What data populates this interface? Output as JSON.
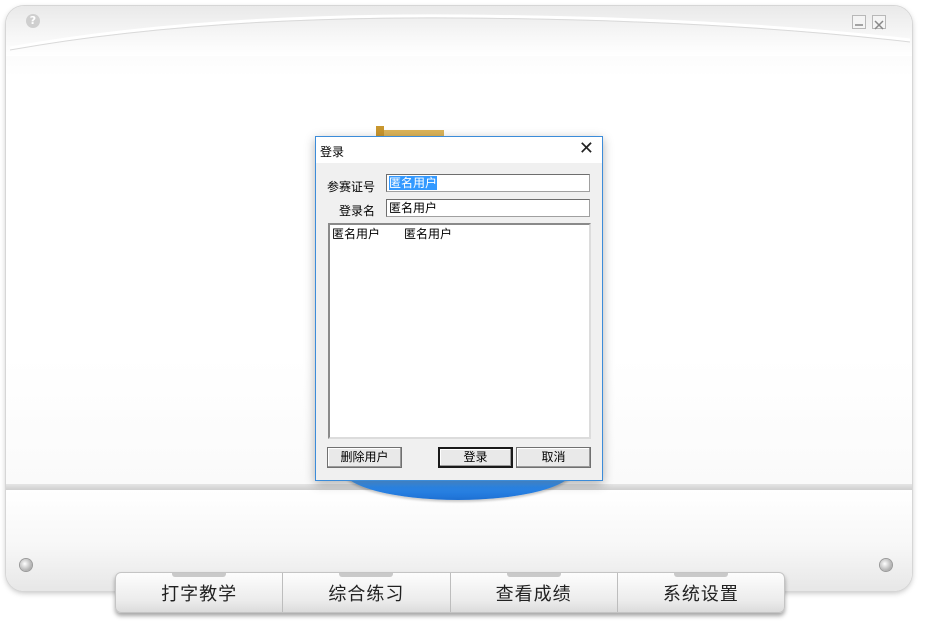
{
  "window": {
    "help_glyph": "?"
  },
  "tabs": [
    {
      "label": "打字教学"
    },
    {
      "label": "综合练习"
    },
    {
      "label": "查看成绩"
    },
    {
      "label": "系统设置"
    }
  ],
  "login_dialog": {
    "title": "登录",
    "close_glyph": "✕",
    "id_label": "参赛证号",
    "id_value": "匿名用户",
    "name_label": "登录名",
    "name_value": "匿名用户",
    "user_list": [
      {
        "id": "匿名用户",
        "name": "匿名用户"
      }
    ],
    "delete_user_label": "删除用户",
    "login_label": "登录",
    "cancel_label": "取消"
  },
  "colors": {
    "selection": "#3399ff",
    "dialog_border": "#3c8cd9",
    "disc": "#2e8cf0"
  }
}
